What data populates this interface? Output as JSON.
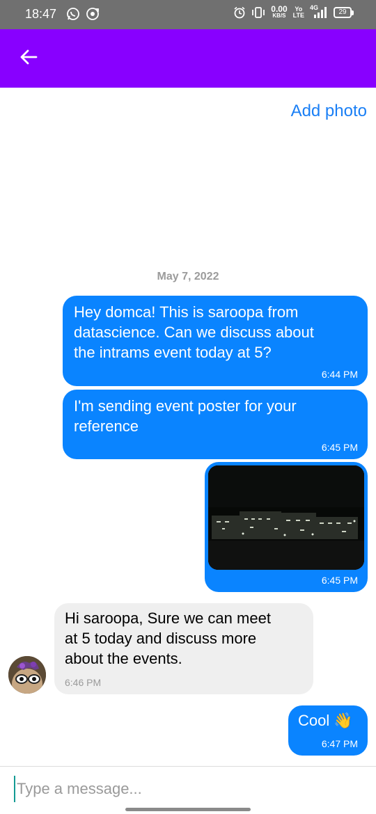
{
  "status_bar": {
    "time": "18:47",
    "net_speed": "0.00",
    "net_speed_unit": "KB/S",
    "volte_top": "Yo",
    "volte_bottom": "LTE",
    "network": "4G",
    "battery": "29",
    "left_icons": [
      "whatsapp-icon",
      "sync-icon"
    ],
    "right_icons": [
      "alarm-icon",
      "vibrate-icon",
      "signal-icon",
      "battery-icon"
    ]
  },
  "app_bar": {
    "back_icon": "arrow-left-icon",
    "color": "#8800ff"
  },
  "header": {
    "add_photo_label": "Add photo"
  },
  "conversation": {
    "date": "May 7, 2022",
    "messages": [
      {
        "direction": "outgoing",
        "text": "Hey domca! This is saroopa from\ndatascience. Can we discuss about\nthe intrams event today at 5?",
        "time": "6:44 PM"
      },
      {
        "direction": "outgoing",
        "text": "I'm sending event poster for your\nreference",
        "time": "6:45 PM"
      },
      {
        "direction": "outgoing",
        "type": "image",
        "time": "6:45 PM"
      },
      {
        "direction": "incoming",
        "text": "Hi saroopa, Sure we can meet\nat 5 today and discuss more\nabout the events.",
        "time": "6:46 PM"
      },
      {
        "direction": "outgoing",
        "text": "Cool 👋",
        "time": "6:47 PM"
      }
    ]
  },
  "composer": {
    "placeholder": "Type a message..."
  },
  "colors": {
    "outgoing_bubble": "#0a84ff",
    "incoming_bubble": "#efefef",
    "link": "#1a7ff5"
  }
}
